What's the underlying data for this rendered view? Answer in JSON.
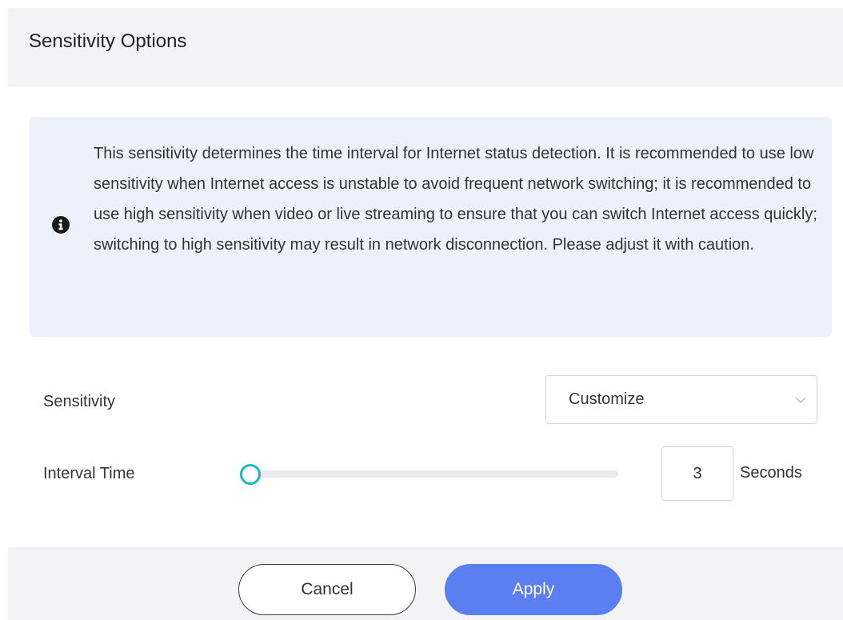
{
  "dialog": {
    "title": "Sensitivity Options"
  },
  "info": {
    "icon": "info-circle-icon",
    "text": "This sensitivity determines the time interval for Internet status detection. It is recommended to use low sensitivity when Internet access is unstable to avoid frequent network switching; it is recommended to use high sensitivity when video or live streaming to ensure that you can switch Internet access quickly; switching to high sensitivity may result in network disconnection. Please adjust it with caution."
  },
  "sensitivity": {
    "label": "Sensitivity",
    "selected": "Customize",
    "icon": "chevron-down-icon"
  },
  "interval": {
    "label": "Interval Time",
    "value": "3",
    "unit": "Seconds",
    "slider_fraction": 0.0
  },
  "buttons": {
    "cancel": "Cancel",
    "apply": "Apply"
  },
  "colors": {
    "accent": "#5b7ff0",
    "slider": "#19b8c4",
    "info_bg": "#edf1fc"
  }
}
